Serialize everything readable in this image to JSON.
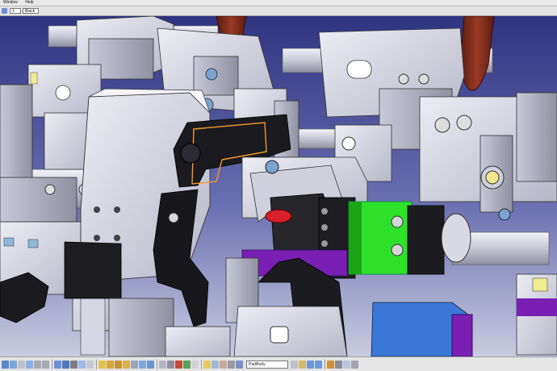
{
  "menubar": {
    "items": [
      "Window",
      "Help"
    ]
  },
  "toolbar_top": {
    "combo_left_value": "1",
    "combo_right_value": "Black"
  },
  "toolbar_bottom": {
    "selection_value": "PartBody"
  },
  "colors": {
    "viewport_top": "#2f3480",
    "viewport_bottom": "#c9cbe0",
    "metal_light": "#d6d6e2",
    "metal_dark": "#9a9aa8",
    "black_part": "#1b1b1f",
    "green_part": "#2fe02a",
    "blue_part": "#3a78d8",
    "purple_part": "#7a1fb3",
    "brown_handle": "#7a2b1c",
    "highlight_orange": "#f39a2a"
  }
}
